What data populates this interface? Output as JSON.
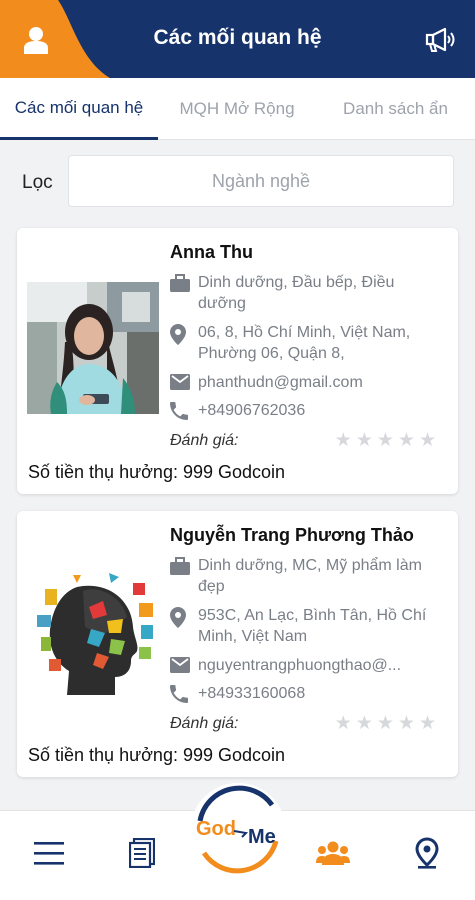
{
  "header": {
    "title": "Các mối quan hệ",
    "user_icon": "user-icon",
    "announce_icon": "megaphone-icon"
  },
  "tabs": [
    {
      "label": "Các mối quan hệ",
      "active": true
    },
    {
      "label": "MQH Mở Rộng",
      "active": false
    },
    {
      "label": "Danh sách ẩn",
      "active": false
    }
  ],
  "filter": {
    "label": "Lọc",
    "placeholder": "Ngành nghề",
    "value": ""
  },
  "contacts": [
    {
      "name": "Anna Thu",
      "profession": "Dinh dưỡng, Đầu bếp, Điều dưỡng",
      "address": "06, 8, Hồ Chí Minh, Việt Nam, Phường 06, Quận 8,",
      "email": "phanthudn@gmail.com",
      "phone": "+84906762036",
      "rating_label": "Đánh giá:",
      "rating": 0,
      "reward": "Số tiền thụ hưởng: 999 Godcoin"
    },
    {
      "name": "Nguyễn Trang Phương Thảo",
      "profession": "Dinh dưỡng, MC, Mỹ phẩm làm đẹp",
      "address": "953C, An Lạc, Bình Tân, Hồ Chí Minh, Việt Nam",
      "email": "nguyentrangphuongthao@...",
      "phone": "+84933160068",
      "rating_label": "Đánh giá:",
      "rating": 0,
      "reward": "Số tiền thụ hưởng: 999 Godcoin"
    }
  ],
  "bottom_nav": {
    "logo_text_left": "God",
    "logo_text_right": "Me",
    "items": [
      "menu-icon",
      "document-icon",
      "logo",
      "people-icon",
      "location-pin-icon"
    ]
  },
  "colors": {
    "navy": "#16336b",
    "orange": "#f28c1c",
    "background": "#f1f2f4",
    "muted_text": "#7a7f87"
  }
}
